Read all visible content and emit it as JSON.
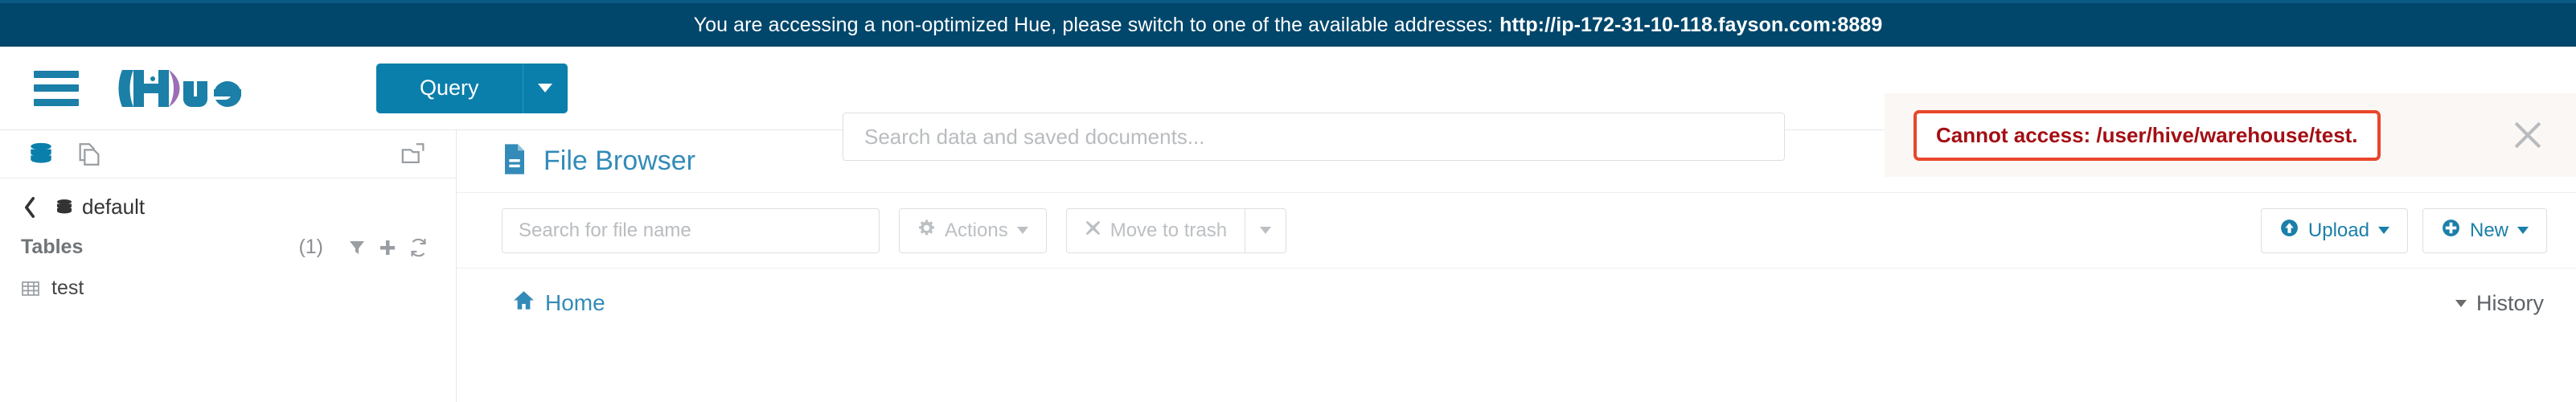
{
  "banner": {
    "message": "You are accessing a non-optimized Hue, please switch to one of the available addresses:",
    "url": "http://ip-172-31-10-118.fayson.com:8889"
  },
  "navbar": {
    "menu_icon": "hamburger-icon",
    "logo_text": "Hue",
    "query_label": "Query",
    "search_placeholder": "Search data and saved documents..."
  },
  "alert": {
    "message": "Cannot access: /user/hive/warehouse/test.",
    "close_icon": "close-icon",
    "border_color": "#e8462c",
    "text_color": "#a30f14"
  },
  "sidebar": {
    "icons": [
      {
        "name": "database-icon",
        "active": true
      },
      {
        "name": "documents-icon",
        "active": false
      },
      {
        "name": "folder-open-icon",
        "active": false
      }
    ],
    "breadcrumb_db": "default",
    "tables_label": "Tables",
    "tables_count": "(1)",
    "table_actions": [
      "filter-icon",
      "plus-icon",
      "refresh-icon"
    ],
    "tables": [
      {
        "name": "test"
      }
    ]
  },
  "main": {
    "page_title": "File Browser",
    "toolbar": {
      "search_placeholder": "Search for file name",
      "actions_label": "Actions",
      "move_to_trash_label": "Move to trash",
      "upload_label": "Upload",
      "new_label": "New"
    },
    "breadcrumb": {
      "home_label": "Home"
    },
    "history_label": "History"
  },
  "colors": {
    "banner_bg": "#01466b",
    "accent": "#0b7fab",
    "link": "#338bb8"
  }
}
